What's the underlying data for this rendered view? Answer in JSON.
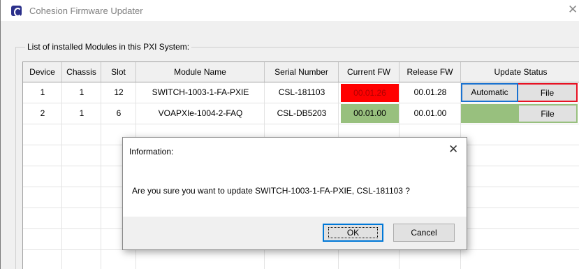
{
  "window": {
    "title": "Cohesion Firmware Updater",
    "close_glyph": "✕",
    "icon": "cohesion-app-icon"
  },
  "group": {
    "label": "List of installed Modules in this PXI System:"
  },
  "table": {
    "headers": {
      "device": "Device",
      "chassis": "Chassis",
      "slot": "Slot",
      "module": "Module Name",
      "serial": "Serial Number",
      "current": "Current FW",
      "release": "Release FW",
      "status": "Update Status"
    },
    "rows": [
      {
        "device": "1",
        "chassis": "1",
        "slot": "12",
        "module": "SWITCH-1003-1-FA-PXIE",
        "serial": "CSL-181103",
        "current": "00.01.26",
        "release": "00.01.28",
        "auto_label": "Automatic",
        "file_label": "File"
      },
      {
        "device": "2",
        "chassis": "1",
        "slot": "6",
        "module": "VOAPXIe-1004-2-FAQ",
        "serial": "CSL-DB5203",
        "current": "00.01.00",
        "release": "00.01.00",
        "auto_label": "",
        "file_label": "File"
      }
    ]
  },
  "dialog": {
    "title": "Information:",
    "close_glyph": "✕",
    "message": "Are you sure you want to update SWITCH-1003-1-FA-PXIE, CSL-181103 ?",
    "ok_label": "OK",
    "cancel_label": "Cancel"
  },
  "colors": {
    "outdated_fw": "#ff0000",
    "current_fw": "#98c07e",
    "focus_blue": "#1a72d0",
    "alert_red_border": "#e81123"
  }
}
